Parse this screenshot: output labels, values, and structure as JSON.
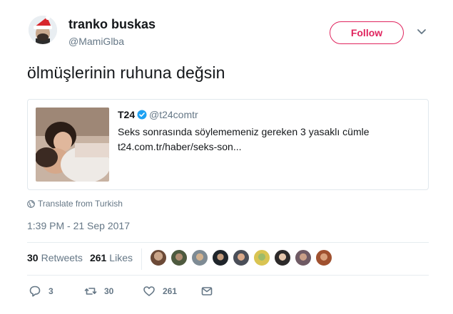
{
  "author": {
    "name": "tranko buskas",
    "handle": "@MamiGlba"
  },
  "follow_label": "Follow",
  "tweet_text": "ölmüşlerinin ruhuna değsin",
  "quoted": {
    "name": "T24",
    "handle": "@t24comtr",
    "line1": "Seks sonrasında söylememeniz gereken 3 yasaklı cümle",
    "line2": "t24.com.tr/haber/seks-son..."
  },
  "translate_label": "Translate from Turkish",
  "timestamp": "1:39 PM - 21 Sep 2017",
  "stats": {
    "retweets_count": "30",
    "retweets_label": "Retweets",
    "likes_count": "261",
    "likes_label": "Likes"
  },
  "actions": {
    "reply_count": "3",
    "retweet_count": "30",
    "like_count": "261"
  },
  "colors": {
    "accent": "#e0245e",
    "muted": "#657786",
    "verified": "#1da1f2"
  },
  "icons": [
    "chevron-down-icon",
    "verified-icon",
    "globe-icon",
    "reply-icon",
    "retweet-icon",
    "heart-icon",
    "envelope-icon"
  ]
}
